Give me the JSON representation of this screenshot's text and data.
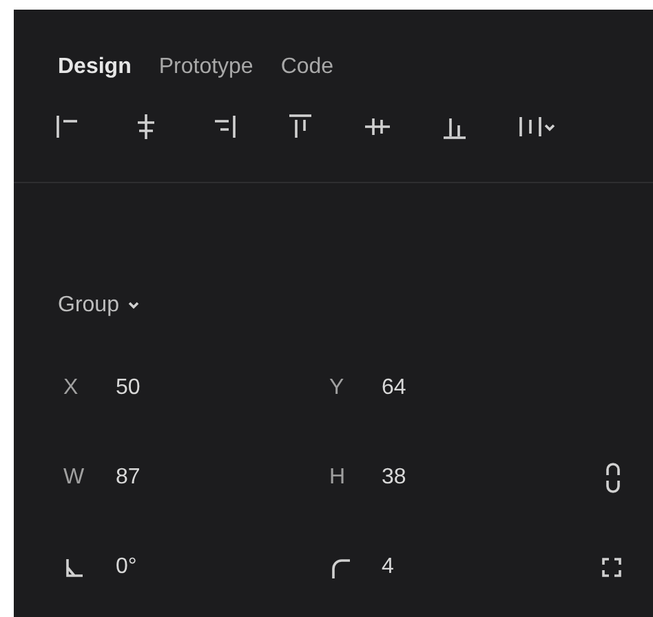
{
  "tabs": [
    {
      "label": "Design",
      "selected": true
    },
    {
      "label": "Prototype",
      "selected": false
    },
    {
      "label": "Code",
      "selected": false
    }
  ],
  "layer": {
    "label": "Group"
  },
  "rows": [
    {
      "kind": "position",
      "fields": [
        {
          "kind": "letter",
          "label": "X",
          "value": "50"
        },
        {
          "kind": "letter",
          "label": "Y",
          "value": "64"
        }
      ]
    },
    {
      "kind": "size",
      "fields": [
        {
          "kind": "letter",
          "label": "W",
          "value": "87"
        },
        {
          "kind": "letter",
          "label": "H",
          "value": "38"
        }
      ]
    },
    {
      "kind": "shape",
      "fields": [
        {
          "kind": "rotation",
          "value": "0°"
        },
        {
          "kind": "radius",
          "value": "4"
        }
      ]
    }
  ]
}
